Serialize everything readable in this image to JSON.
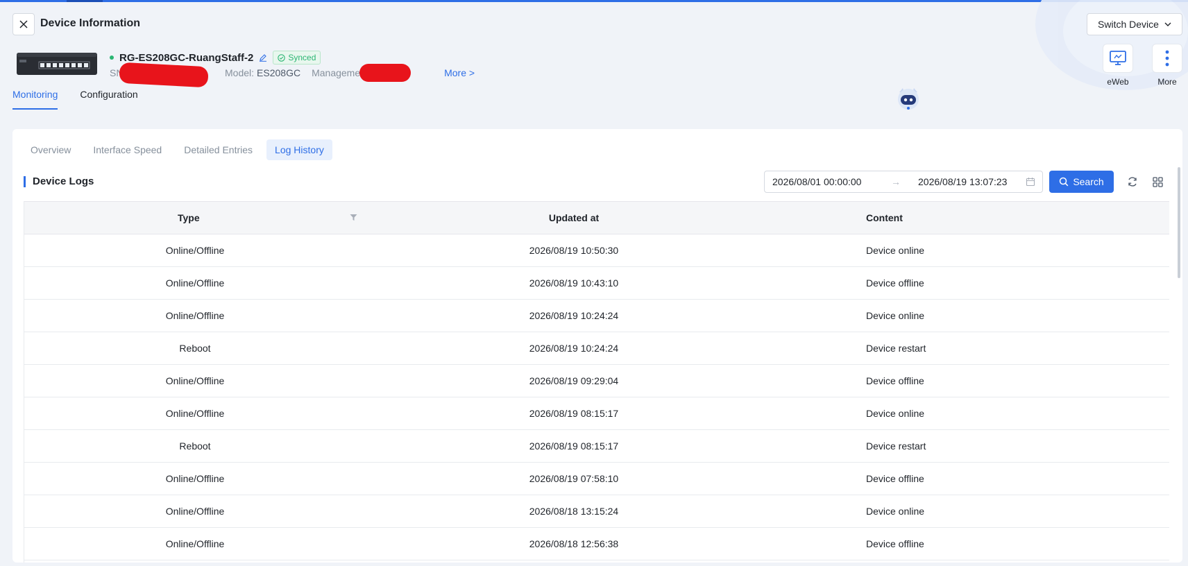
{
  "header": {
    "title": "Device Information",
    "switch_device_label": "Switch Device",
    "actions": [
      {
        "label": "eWeb",
        "icon": "monitor-icon"
      },
      {
        "label": "More",
        "icon": "more-vertical-icon"
      }
    ]
  },
  "device": {
    "name": "RG-ES208GC-RuangStaff-2",
    "status_badge": "Synced",
    "sn_label": "SN",
    "model_label": "Model:",
    "model_value": "ES208GC",
    "management_label": "Management I",
    "more_link": "More >"
  },
  "main_tabs": [
    {
      "label": "Monitoring",
      "active": true
    },
    {
      "label": "Configuration",
      "active": false
    }
  ],
  "sub_tabs": [
    {
      "label": "Overview",
      "active": false
    },
    {
      "label": "Interface Speed",
      "active": false
    },
    {
      "label": "Detailed Entries",
      "active": false
    },
    {
      "label": "Log History",
      "active": true
    }
  ],
  "logs": {
    "section_title": "Device Logs",
    "date_start": "2026/08/01 00:00:00",
    "date_end": "2026/08/19 13:07:23",
    "search_label": "Search",
    "columns": [
      "Type",
      "Updated at",
      "Content"
    ],
    "rows": [
      {
        "type": "Online/Offline",
        "updated": "2026/08/19 10:50:30",
        "content": "Device online"
      },
      {
        "type": "Online/Offline",
        "updated": "2026/08/19 10:43:10",
        "content": "Device offline"
      },
      {
        "type": "Online/Offline",
        "updated": "2026/08/19 10:24:24",
        "content": "Device online"
      },
      {
        "type": "Reboot",
        "updated": "2026/08/19 10:24:24",
        "content": "Device restart"
      },
      {
        "type": "Online/Offline",
        "updated": "2026/08/19 09:29:04",
        "content": "Device offline"
      },
      {
        "type": "Online/Offline",
        "updated": "2026/08/19 08:15:17",
        "content": "Device online"
      },
      {
        "type": "Reboot",
        "updated": "2026/08/19 08:15:17",
        "content": "Device restart"
      },
      {
        "type": "Online/Offline",
        "updated": "2026/08/19 07:58:10",
        "content": "Device offline"
      },
      {
        "type": "Online/Offline",
        "updated": "2026/08/18 13:15:24",
        "content": "Device online"
      },
      {
        "type": "Online/Offline",
        "updated": "2026/08/18 12:56:38",
        "content": "Device offline"
      }
    ]
  },
  "colors": {
    "accent": "#2e6ee6",
    "online_dot": "#2bb673",
    "synced_bg": "#e8f7ee",
    "redaction": "#e8141b"
  }
}
